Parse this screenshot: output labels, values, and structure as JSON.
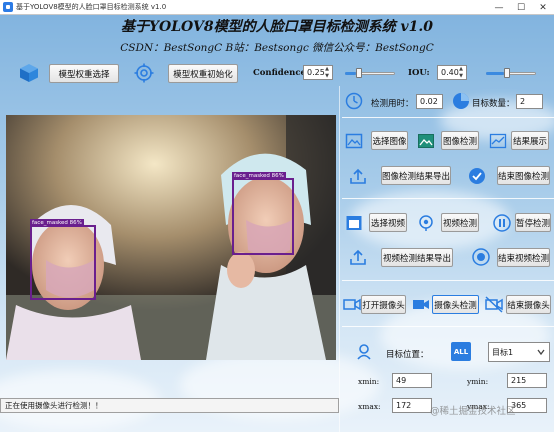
{
  "window": {
    "title": "基于YOLOV8模型的人脸口罩目标检测系统 v1.0",
    "controls": {
      "minimize": "—",
      "maximize": "☐",
      "close": "✕"
    }
  },
  "header": {
    "main_title": "基于YOLOV8模型的人脸口罩目标检测系统 v1.0",
    "sub_title": "CSDN：BestSongC   B站：Bestsongc   微信公众号：BestSongC"
  },
  "toolbar": {
    "select_weights_label": "模型权重选择",
    "init_weights_label": "模型权重初始化",
    "confidence_label": "Confidence:",
    "confidence_value": "0.25",
    "confidence_slider_level": 0.25,
    "iou_label": "IOU:",
    "iou_value": "0.40",
    "iou_slider_level": 0.4
  },
  "detections": [
    {
      "label": "face_masked 86%"
    },
    {
      "label": "face_masked 86%"
    }
  ],
  "status": {
    "message": "正在使用摄像头进行检测！！"
  },
  "stats": {
    "time_label": "检测用时：",
    "time_value": "0.02",
    "count_label": "目标数量：",
    "count_value": "2"
  },
  "image_section": {
    "select_label": "选择图像",
    "detect_label": "图像检测",
    "show_label": "结果展示",
    "export_label": "图像检测结果导出",
    "finish_label": "结束图像检测"
  },
  "video_section": {
    "select_label": "选择视频",
    "detect_label": "视频检测",
    "pause_label": "暂停检测",
    "export_label": "视频检测结果导出",
    "finish_label": "结束视频检测"
  },
  "camera_section": {
    "open_label": "打开摄像头",
    "detect_label": "摄像头检测",
    "close_label": "结束摄像头"
  },
  "target_position": {
    "label": "目标位置：",
    "all_badge": "ALL",
    "selected_target": "目标1",
    "xmin_label": "xmin:",
    "xmin_value": "49",
    "ymin_label": "ymin:",
    "ymin_value": "215",
    "xmax_label": "xmax:",
    "xmax_value": "172",
    "ymax_label": "ymax:",
    "ymax_value": "365"
  },
  "watermark": "@稀土掘金技术社区",
  "colors": {
    "accent": "#2b7de0",
    "detection_box": "#6a1f8e"
  }
}
